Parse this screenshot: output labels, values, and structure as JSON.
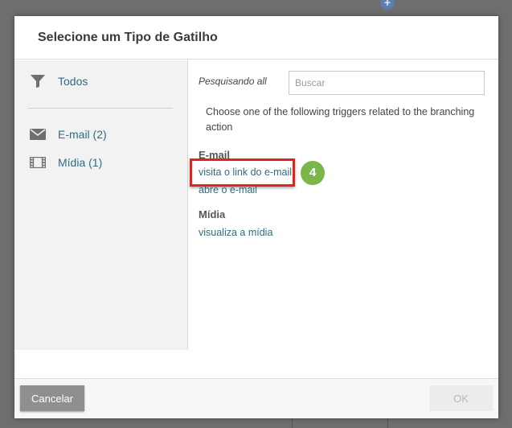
{
  "background": {
    "add_icon": "plus-circle-icon"
  },
  "dialog": {
    "title": "Selecione um Tipo de Gatilho",
    "sidebar": {
      "filters": [
        {
          "label": "Todos",
          "icon": "funnel-icon"
        },
        {
          "label": "E-mail (2)",
          "icon": "envelope-icon"
        },
        {
          "label": "Mídia (1)",
          "icon": "film-icon"
        }
      ]
    },
    "search": {
      "label": "Pesquisando all",
      "placeholder": "Buscar",
      "value": ""
    },
    "instructions": "Choose one of the following triggers related to the branching action",
    "groups": [
      {
        "title": "E-mail",
        "links": [
          "visita o link do e-mail",
          "abre o e-mail"
        ]
      },
      {
        "title": "Mídia",
        "links": [
          "visualiza a mídia"
        ]
      }
    ],
    "step_badge": "4",
    "highlight_color": "#e2231a",
    "footer": {
      "cancel_label": "Cancelar",
      "ok_label": "OK"
    }
  }
}
